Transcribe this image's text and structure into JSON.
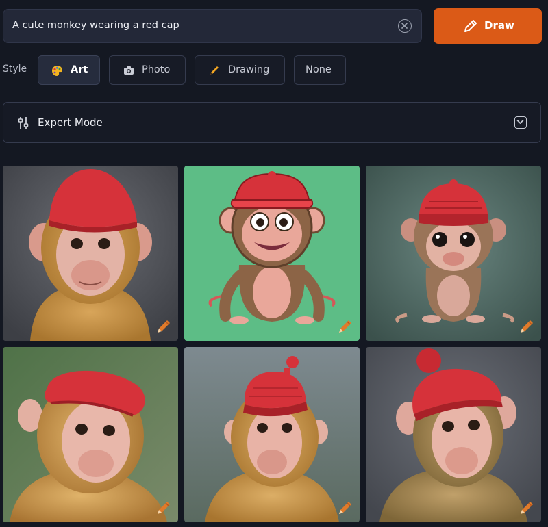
{
  "prompt": {
    "value": "A cute monkey wearing a red cap",
    "clear_icon": "clear-circle-x-icon"
  },
  "draw_button": {
    "label": "Draw",
    "icon": "pencil-icon",
    "color": "#db5a17"
  },
  "style": {
    "label": "Style",
    "options": [
      {
        "label": "Art",
        "icon": "palette-icon",
        "selected": true
      },
      {
        "label": "Photo",
        "icon": "camera-icon",
        "selected": false
      },
      {
        "label": "Drawing",
        "icon": "pencil-icon",
        "selected": false
      },
      {
        "label": "None",
        "icon": "",
        "selected": false
      }
    ]
  },
  "expert_mode": {
    "label": "Expert Mode",
    "icon": "sliders-icon",
    "expanded": false
  },
  "gallery": {
    "items": [
      {
        "subject": "photo monkey with red knit beanie",
        "background": "#4a4c52"
      },
      {
        "subject": "cartoon monkey with red cap",
        "background": "#5dbd86"
      },
      {
        "subject": "cartoon monkey with red beanie",
        "background": "#4e6660"
      },
      {
        "subject": "photo monkey with red beret",
        "background": "#5f7a55"
      },
      {
        "subject": "photo monkey with red knit cap",
        "background": "#6e7a80"
      },
      {
        "subject": "photo monkey with red pom-pom hat",
        "background": "#5a5e66"
      }
    ],
    "edit_icon": "edit-pencil-icon"
  },
  "colors": {
    "page_bg": "#141822",
    "accent": "#db5a17",
    "hat_red": "#d6323a"
  }
}
